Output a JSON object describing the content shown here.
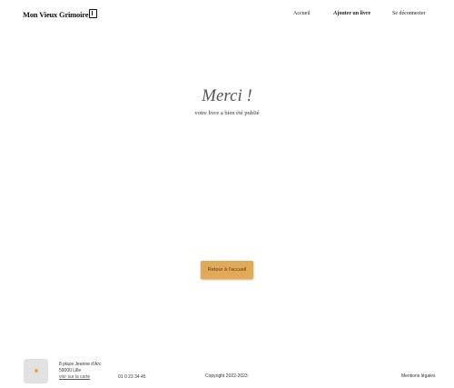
{
  "header": {
    "logo_text": "Mon Vieux Grimoire",
    "nav": {
      "home": "Accueil",
      "add_book": "Ajouter un livre",
      "logout": "Se déconnecter"
    }
  },
  "main": {
    "title": "Merci !",
    "subtitle": "votre livre a bien été publié",
    "back_button": "Retour à l'accueil"
  },
  "footer": {
    "map_icon": "map-pin-icon",
    "address_line1": "8 place Jeanne d'Arc",
    "address_line2": "59000 Lille",
    "map_link": "voir sur la carte",
    "phone": "01 0 23 34 45",
    "copyright": "Copyright 2022-2023",
    "legal": "Mentions légales"
  },
  "colors": {
    "accent": "#e2aa57"
  }
}
